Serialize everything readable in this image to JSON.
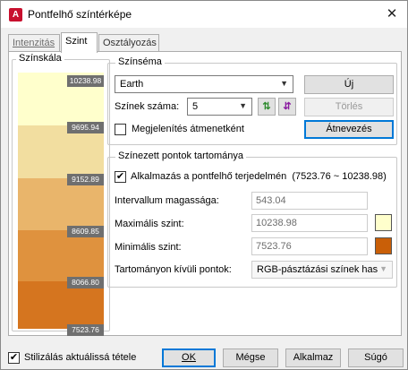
{
  "window": {
    "title": "Pontfelhő színtérképe",
    "app_icon_letter": "A",
    "close_glyph": "✕"
  },
  "tabs": [
    {
      "label": "Intenzitás",
      "state": "disabled"
    },
    {
      "label": "Szint",
      "state": "active"
    },
    {
      "label": "Osztályozás",
      "state": "normal"
    }
  ],
  "scale": {
    "title": "Színskála",
    "labels": [
      "10238.98",
      "9695.94",
      "9152.89",
      "8609.85",
      "8066.80",
      "7523.76"
    ],
    "band_colors": [
      "#ffffcc",
      "#f2dea0",
      "#e9b56b",
      "#df923e",
      "#d5751f",
      "#c95f08"
    ]
  },
  "scheme": {
    "group_title": "Színséma",
    "selected": "Earth",
    "new_button": "Új",
    "count_label": "Színek száma:",
    "count_value": "5",
    "delete_button": "Törlés",
    "show_gradient_label": "Megjelenítés átmenetként",
    "show_gradient_checked": false,
    "rename_button": "Átnevezés",
    "swap_icon_glyph": "⇅",
    "invert_icon_glyph": "⇵"
  },
  "range": {
    "group_title": "Színezett pontok tartománya",
    "apply_label": "Alkalmazás a pontfelhő terjedelmén",
    "apply_range_text": "(7523.76 ~ 10238.98)",
    "apply_checked": true,
    "interval_label": "Intervallum magassága:",
    "interval_value": "543.04",
    "max_label": "Maximális szint:",
    "max_value": "10238.98",
    "max_color": "#ffffcc",
    "min_label": "Minimális szint:",
    "min_value": "7523.76",
    "min_color": "#c95f08",
    "outside_label": "Tartományon kívüli pontok:",
    "outside_value": "RGB-pásztázási színek has"
  },
  "footer": {
    "stylize_label": "Stilizálás aktuálissá tétele",
    "stylize_checked": true,
    "ok": "OK",
    "cancel": "Mégse",
    "apply": "Alkalmaz",
    "help": "Súgó"
  }
}
